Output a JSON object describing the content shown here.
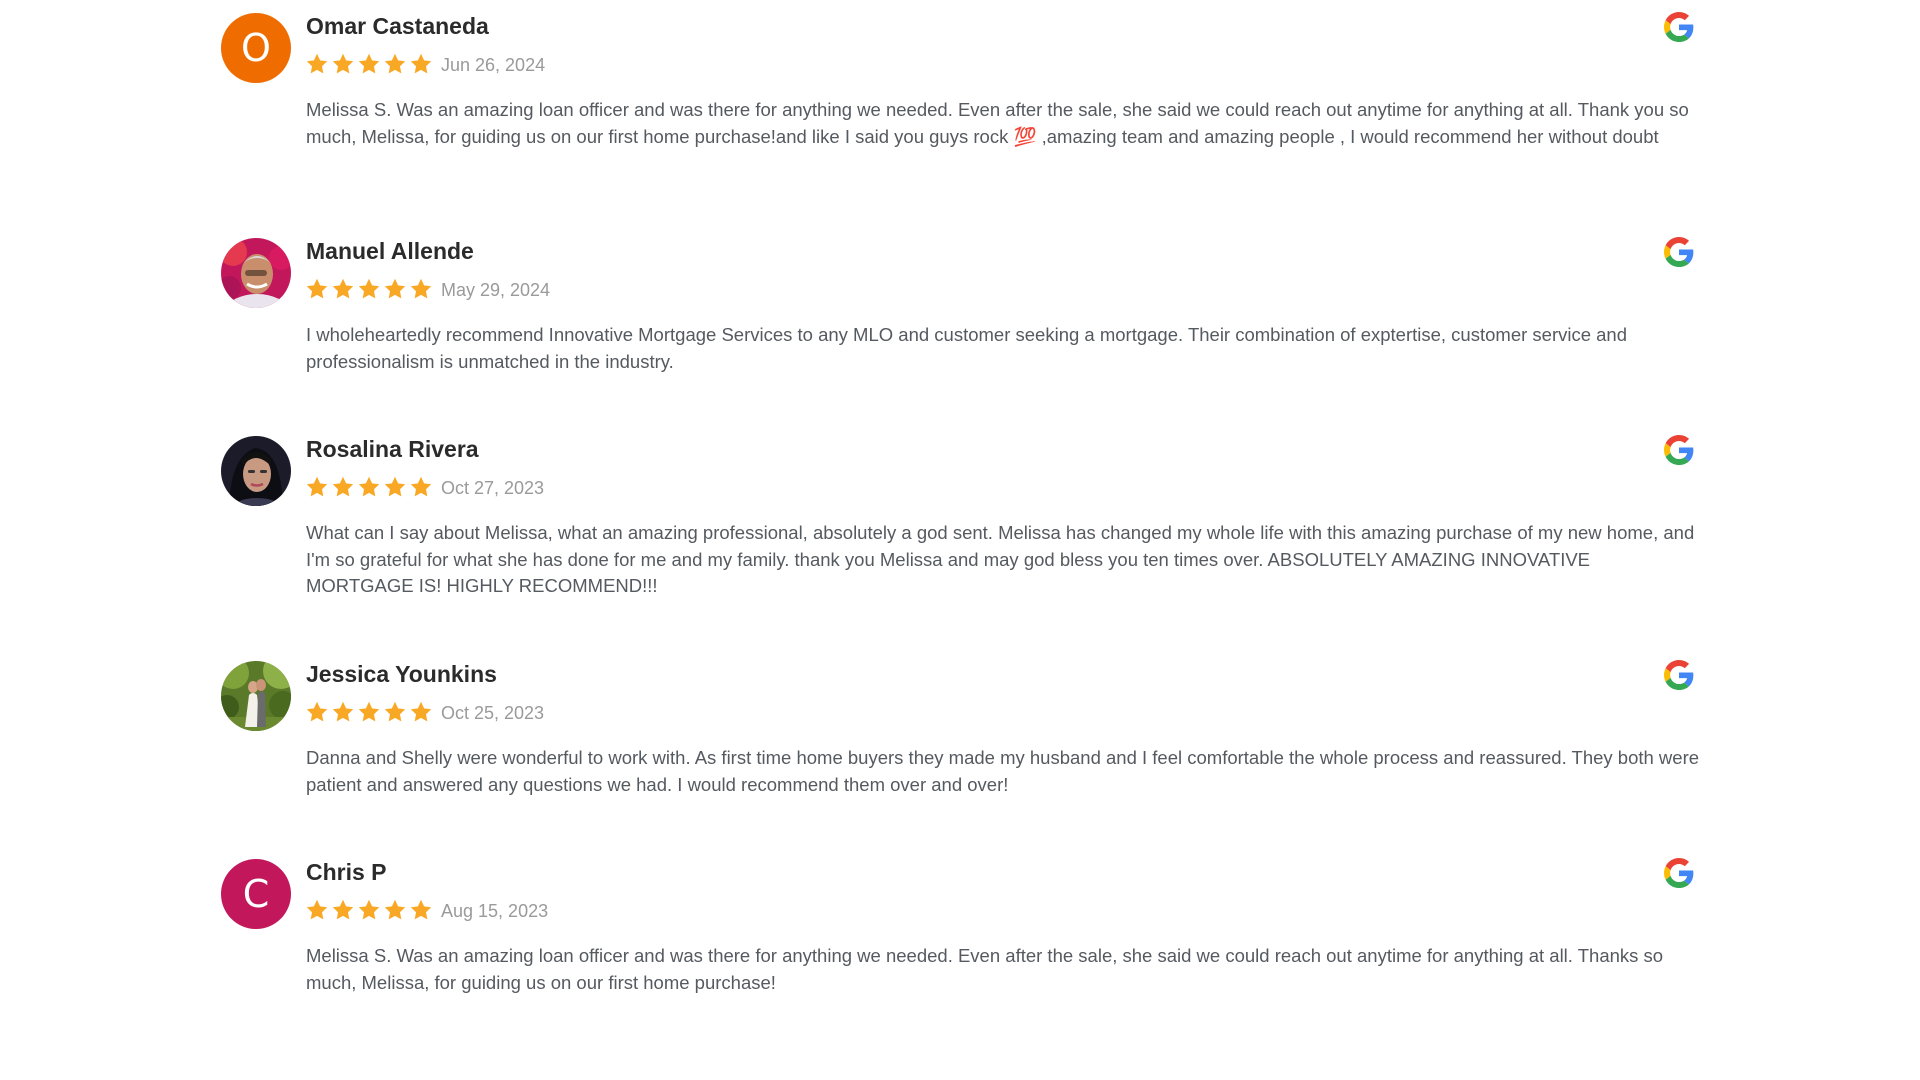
{
  "reviews": [
    {
      "name": "Omar Castaneda",
      "initial": "O",
      "avatar_type": "initial",
      "avatar_color": "#ef6c00",
      "rating": 5,
      "date": "Jun 26, 2024",
      "text": "Melissa S. Was an amazing loan officer and was there for anything we needed. Even after the sale, she said we could reach out anytime for anything at all. Thank you so much, Melissa, for guiding us on our first home purchase!and like I said you guys rock 💯 ,amazing team and amazing people , I would recommend her without doubt"
    },
    {
      "name": "Manuel Allende",
      "avatar_type": "photo",
      "avatar_icon": "man-photo-avatar",
      "rating": 5,
      "date": "May 29, 2024",
      "text": "I wholeheartedly recommend Innovative Mortgage Services to any MLO and customer seeking a mortgage. Their combination of exptertise, customer service and professionalism is unmatched in the industry."
    },
    {
      "name": "Rosalina Rivera",
      "avatar_type": "photo",
      "avatar_icon": "woman-photo-avatar",
      "rating": 5,
      "date": "Oct 27, 2023",
      "text": "What can I say about Melissa, what an amazing professional, absolutely a god sent. Melissa has changed my whole life with this amazing purchase of my new home, and I'm so grateful for what she has done for me and my family. thank you Melissa and may god bless you ten times over. ABSOLUTELY AMAZING INNOVATIVE MORTGAGE IS! HIGHLY RECOMMEND!!!"
    },
    {
      "name": "Jessica Younkins",
      "avatar_type": "photo",
      "avatar_icon": "couple-photo-avatar",
      "rating": 5,
      "date": "Oct 25, 2023",
      "text": "Danna and Shelly were wonderful to work with. As first time home buyers they made my husband and I feel comfortable the whole process and reassured. They both were patient and answered any questions we had. I would recommend them over and over!"
    },
    {
      "name": "Chris P",
      "initial": "C",
      "avatar_type": "initial",
      "avatar_color": "#c2185b",
      "rating": 5,
      "date": "Aug 15, 2023",
      "text": "Melissa S. Was an amazing loan officer and was there for anything we needed. Even after the sale, she said we could reach out anytime for anything at all. Thanks so much, Melissa, for guiding us on our first home purchase!"
    }
  ],
  "colors": {
    "star": "#f9a825",
    "name": "#2b2b2b",
    "date": "#9a9a9a",
    "text": "#555a60"
  },
  "icons": {
    "source": "google-g-icon",
    "rating": "star-icon"
  }
}
